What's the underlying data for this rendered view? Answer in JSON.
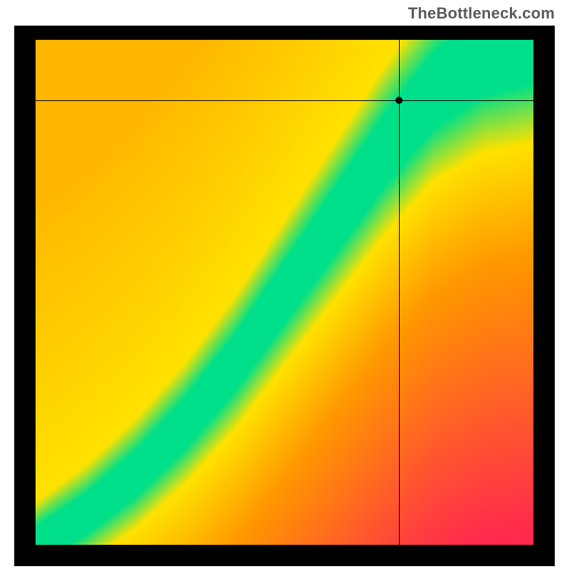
{
  "watermark": "TheBottleneck.com",
  "chart_data": {
    "type": "heatmap",
    "title": "",
    "xlabel": "",
    "ylabel": "",
    "xlim": [
      0,
      100
    ],
    "ylim": [
      0,
      100
    ],
    "grid": false,
    "legend": false,
    "crosshair": {
      "x": 73,
      "y": 88
    },
    "marker": {
      "x": 73,
      "y": 88
    },
    "optimal_band": {
      "description": "Green band along a rising curve; red far from it; yellow near it",
      "curve_points": [
        {
          "x": 0,
          "y": 0
        },
        {
          "x": 10,
          "y": 6
        },
        {
          "x": 20,
          "y": 14
        },
        {
          "x": 30,
          "y": 24
        },
        {
          "x": 40,
          "y": 36
        },
        {
          "x": 50,
          "y": 50
        },
        {
          "x": 60,
          "y": 64
        },
        {
          "x": 70,
          "y": 78
        },
        {
          "x": 80,
          "y": 90
        },
        {
          "x": 90,
          "y": 97
        },
        {
          "x": 100,
          "y": 100
        }
      ],
      "band_half_width": 6
    },
    "corner_colors": {
      "bottom_left": "#ff2a4d",
      "bottom_right": "#ff2a4d",
      "top_left": "#ff2a4d",
      "top_right": "#ffe200"
    },
    "palette": {
      "optimal": "#00e08a",
      "near": "#ffe200",
      "mid": "#ff9a00",
      "far": "#ff2a4d"
    }
  }
}
